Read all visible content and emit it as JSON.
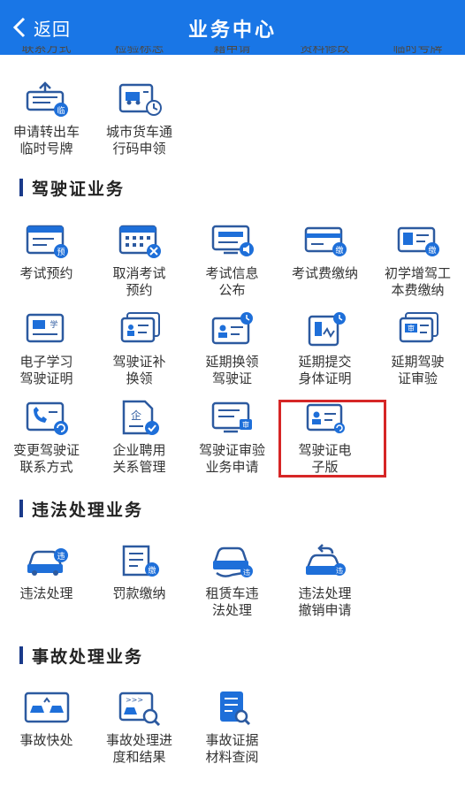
{
  "header": {
    "back_label": "返回",
    "title": "业务中心"
  },
  "partial_row": [
    "联系方式",
    "检验标志",
    "籍申请",
    "资料修改",
    "临时号牌"
  ],
  "top_items": [
    {
      "label": "申请转出车\n临时号牌",
      "icon": "plate-out-icon",
      "badge": "临"
    },
    {
      "label": "城市货车通\n行码申领",
      "icon": "truck-pass-icon"
    }
  ],
  "sections": {
    "license": {
      "title": "驾驶证业务",
      "items": [
        {
          "label": "考试预约",
          "icon": "exam-appointment-icon",
          "badge": "预"
        },
        {
          "label": "取消考试\n预约",
          "icon": "cancel-exam-icon",
          "badge": "×"
        },
        {
          "label": "考试信息\n公布",
          "icon": "exam-info-icon",
          "badge": "🔊"
        },
        {
          "label": "考试费缴纳",
          "icon": "exam-fee-icon",
          "badge": "缴"
        },
        {
          "label": "初学增驾工\n本费缴纳",
          "icon": "learner-fee-icon",
          "badge": "缴"
        },
        {
          "label": "电子学习\n驾驶证明",
          "icon": "e-learning-icon",
          "badge": "学"
        },
        {
          "label": "驾驶证补\n换领",
          "icon": "license-replace-icon"
        },
        {
          "label": "延期换领\n驾驶证",
          "icon": "delay-renew-icon"
        },
        {
          "label": "延期提交\n身体证明",
          "icon": "delay-health-icon"
        },
        {
          "label": "延期驾驶\n证审验",
          "icon": "delay-review-icon",
          "badge": "审"
        },
        {
          "label": "变更驾驶证\n联系方式",
          "icon": "change-contact-icon"
        },
        {
          "label": "企业聘用\n关系管理",
          "icon": "enterprise-icon",
          "badge": "企"
        },
        {
          "label": "驾驶证审验\n业务申请",
          "icon": "review-apply-icon",
          "badge": "审"
        },
        {
          "label": "驾驶证电\n子版",
          "icon": "e-license-icon"
        }
      ]
    },
    "violation": {
      "title": "违法处理业务",
      "items": [
        {
          "label": "违法处理",
          "icon": "violation-icon",
          "badge": "违"
        },
        {
          "label": "罚款缴纳",
          "icon": "fine-icon",
          "badge": "缴"
        },
        {
          "label": "租赁车违\n法处理",
          "icon": "rental-violation-icon",
          "badge": "违"
        },
        {
          "label": "违法处理\n撤销申请",
          "icon": "violation-revoke-icon",
          "badge": "违"
        }
      ]
    },
    "accident": {
      "title": "事故处理业务",
      "items": [
        {
          "label": "事故快处",
          "icon": "accident-quick-icon"
        },
        {
          "label": "事故处理进\n度和结果",
          "icon": "accident-progress-icon"
        },
        {
          "label": "事故证据\n材料查阅",
          "icon": "accident-evidence-icon"
        }
      ]
    }
  },
  "colors": {
    "header": "#1976e6",
    "icon_blue": "#1e6fd9",
    "icon_dark": "#2c5aa0",
    "highlight": "#d62626"
  }
}
